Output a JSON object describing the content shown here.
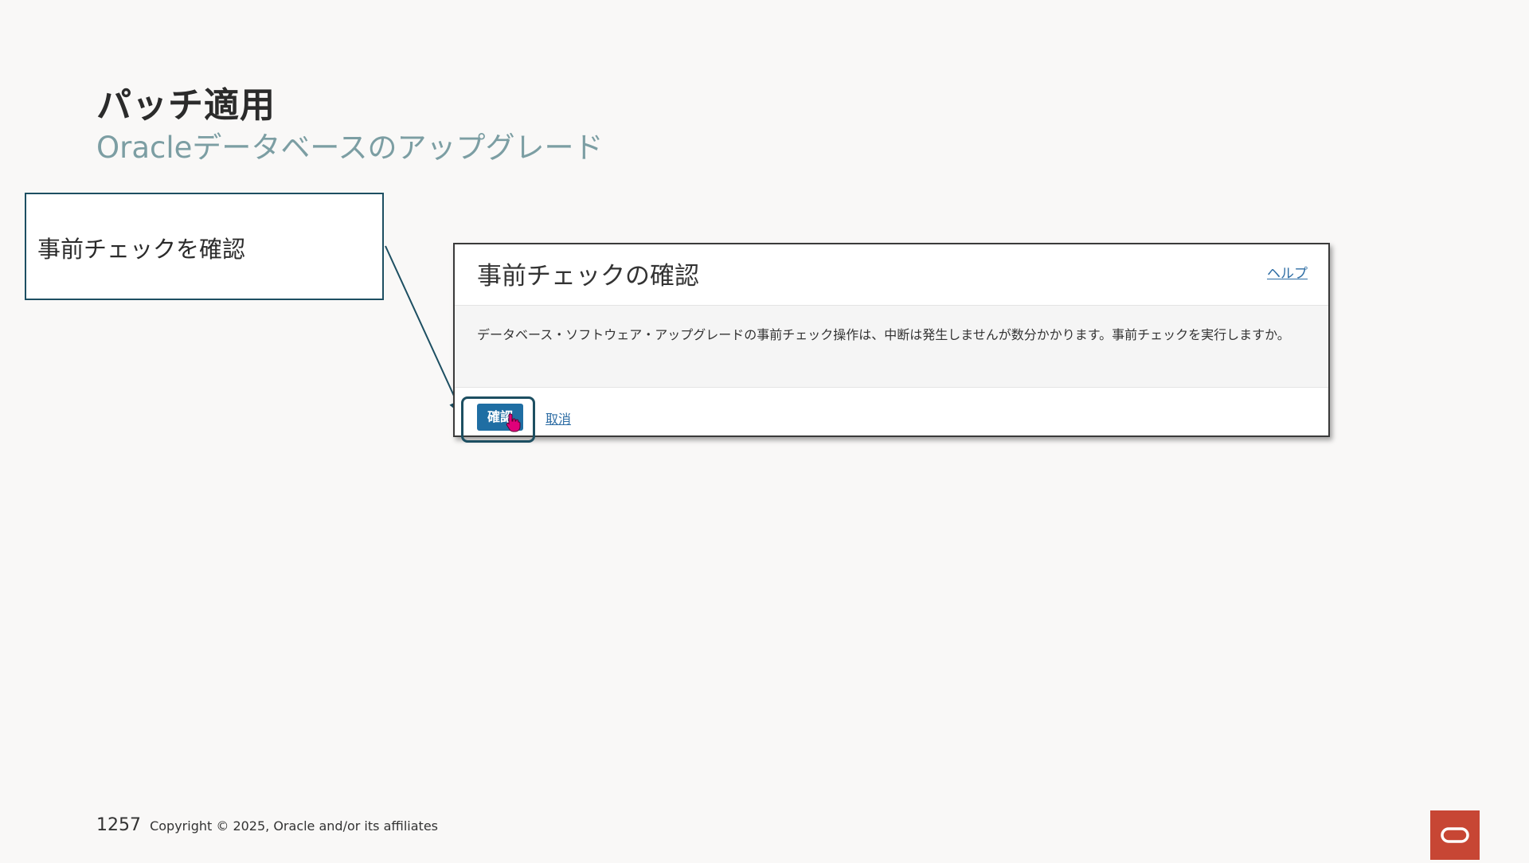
{
  "slide": {
    "title": "パッチ適用",
    "subtitle": "Oracleデータベースのアップグレード"
  },
  "callout": {
    "text": "事前チェックを確認"
  },
  "dialog": {
    "title": "事前チェックの確認",
    "help_label": "ヘルプ",
    "message": "データベース・ソフトウェア・アップグレードの事前チェック操作は、中断は発生しませんが数分かかります。事前チェックを実行しますか。",
    "confirm_label": "確認",
    "cancel_label": "取消"
  },
  "footer": {
    "page_number": "1257",
    "copyright": "Copyright © 2025, Oracle and/or its affiliates"
  },
  "colors": {
    "background": "#f9f8f7",
    "callout_border": "#1d4f62",
    "confirm_button": "#1f6ea3",
    "link": "#2e6da4",
    "subtitle": "#7c9ea3",
    "oracle_red": "#c74634",
    "cursor_pink": "#e0007a"
  },
  "icons": {
    "cursor": "hand-pointer-icon",
    "logo": "oracle-logo-icon"
  }
}
